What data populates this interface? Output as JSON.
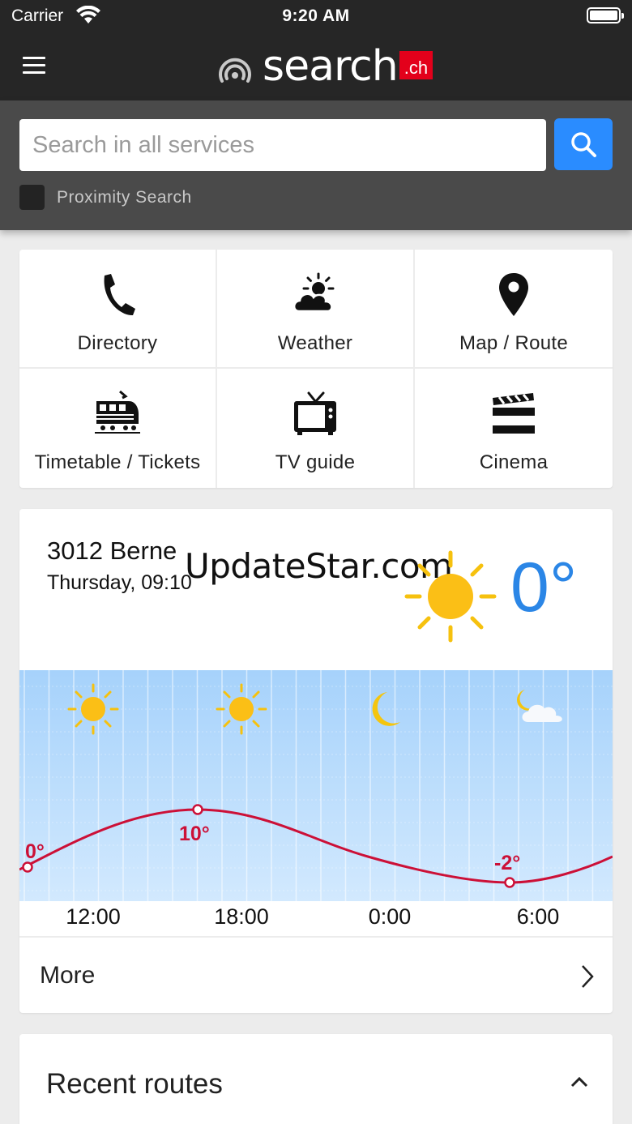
{
  "status_bar": {
    "carrier": "Carrier",
    "time": "9:20 AM"
  },
  "header": {
    "logo_text": "search",
    "logo_suffix": ".ch"
  },
  "search": {
    "placeholder": "Search in all services",
    "proximity_label": "Proximity Search"
  },
  "services": [
    {
      "label": "Directory",
      "icon": "phone-icon"
    },
    {
      "label": "Weather",
      "icon": "weather-icon"
    },
    {
      "label": "Map / Route",
      "icon": "map-pin-icon"
    },
    {
      "label": "Timetable / Tickets",
      "icon": "train-icon"
    },
    {
      "label": "TV guide",
      "icon": "tv-icon"
    },
    {
      "label": "Cinema",
      "icon": "clapperboard-icon"
    }
  ],
  "weather": {
    "location": "3012 Berne",
    "date": "Thursday, 09:10",
    "current_temp": "0°",
    "watermark": "UpdateStar.com",
    "more_label": "More",
    "times": [
      "12:00",
      "18:00",
      "0:00",
      "6:00"
    ],
    "forecast_labels": [
      "0°",
      "10°",
      "-2°"
    ],
    "forecast_icons": [
      "sun-icon",
      "sun-icon",
      "moon-icon",
      "moon-cloud-icon"
    ],
    "colors": {
      "temp": "#2b86e6",
      "curve": "#cc1037",
      "sky_top": "#a6d2fb",
      "sky_bottom": "#d2e9fe"
    }
  },
  "recent_routes": {
    "title": "Recent routes"
  },
  "colors": {
    "brand_red": "#e3001b",
    "search_button": "#2a8cff",
    "header_bg": "#262626"
  }
}
